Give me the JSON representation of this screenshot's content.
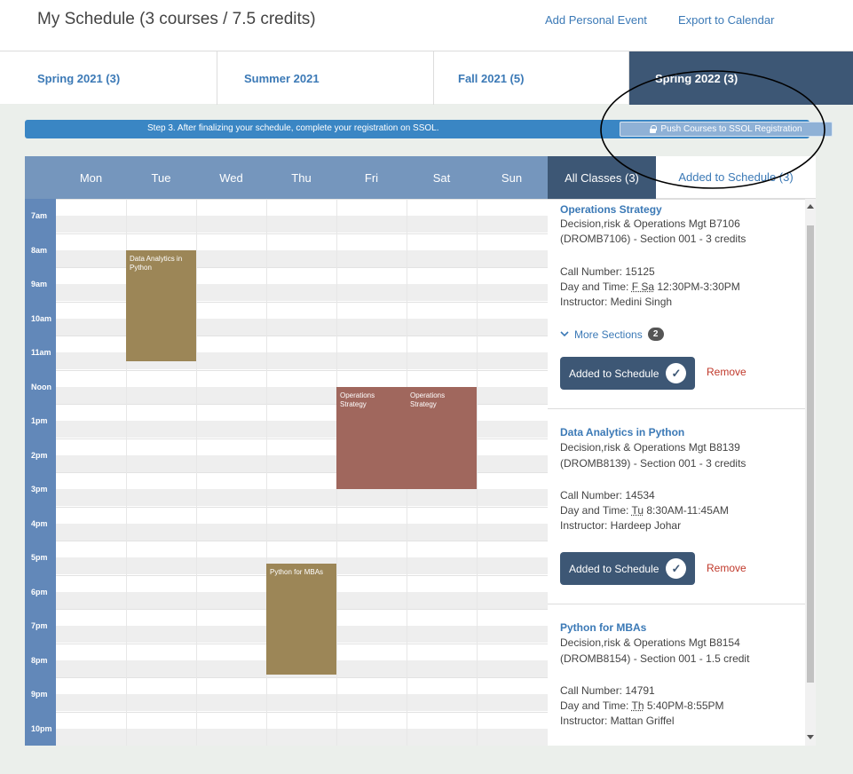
{
  "header": {
    "title": "My Schedule (3 courses / 7.5 credits)",
    "add_event": "Add Personal Event",
    "export": "Export to Calendar"
  },
  "terms": [
    {
      "label": "Spring 2021 (3)"
    },
    {
      "label": "Summer 2021"
    },
    {
      "label": "Fall 2021 (5)"
    },
    {
      "label": "Spring 2022 (3)"
    }
  ],
  "banner": {
    "text": "Step 3. After finalizing your schedule, complete your registration on SSOL.",
    "push_label": "Push Courses to SSOL Registration"
  },
  "calendar": {
    "days": [
      "Mon",
      "Tue",
      "Wed",
      "Thu",
      "Fri",
      "Sat",
      "Sun"
    ],
    "times": [
      "7am",
      "8am",
      "9am",
      "10am",
      "11am",
      "Noon",
      "1pm",
      "2pm",
      "3pm",
      "4pm",
      "5pm",
      "6pm",
      "7pm",
      "8pm",
      "9pm",
      "10pm"
    ],
    "events": [
      {
        "title": "Data Analytics in Python",
        "day": "Tue",
        "start": "8:30",
        "end": "11:45",
        "color": "#9c8657"
      },
      {
        "title": "Operations Strategy",
        "day": "Fri",
        "start": "12:30",
        "end": "15:30",
        "color": "#a0675d"
      },
      {
        "title": "Operations Strategy",
        "day": "Sat",
        "start": "12:30",
        "end": "15:30",
        "color": "#a0675d"
      },
      {
        "title": "Python for MBAs",
        "day": "Thu",
        "start": "17:40",
        "end": "20:55",
        "color": "#9c8657"
      }
    ]
  },
  "panel": {
    "tab_all": "All Classes (3)",
    "tab_added": "Added to Schedule (3)",
    "courses": [
      {
        "title": "Operations Strategy",
        "dept": "Decision,risk & Operations Mgt B7106",
        "section": "(DROMB7106) - Section 001 - 3 credits",
        "call": "Call Number:  15125",
        "dt_prefix": "Day and Time: ",
        "days": "F Sa",
        "time": " 12:30PM-3:30PM",
        "instructor": "Instructor:  Medini Singh",
        "more_label": "More Sections",
        "more_count": "2",
        "added_label": "Added to Schedule",
        "remove_label": "Remove"
      },
      {
        "title": "Data Analytics in Python",
        "dept": "Decision,risk & Operations Mgt B8139",
        "section": "(DROMB8139) - Section 001 - 3 credits",
        "call": "Call Number:  14534",
        "dt_prefix": "Day and Time: ",
        "days": "Tu",
        "time": " 8:30AM-11:45AM",
        "instructor": "Instructor:  Hardeep Johar",
        "added_label": "Added to Schedule",
        "remove_label": "Remove"
      },
      {
        "title": "Python for MBAs",
        "dept": "Decision,risk & Operations Mgt B8154",
        "section": "(DROMB8154) - Section 001 - 1.5 credit",
        "call": "Call Number:  14791",
        "dt_prefix": "Day and Time: ",
        "days": "Th",
        "time": " 5:40PM-8:55PM",
        "instructor": "Instructor:  Mattan Griffel"
      }
    ]
  }
}
